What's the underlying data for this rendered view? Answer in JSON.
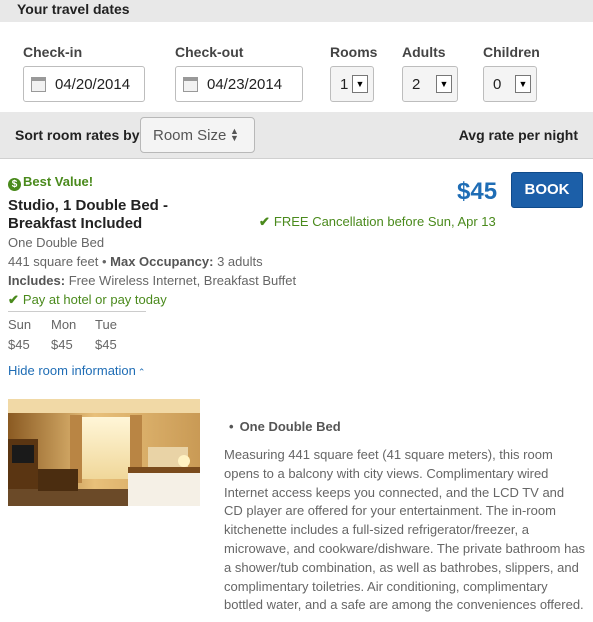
{
  "header": {
    "title": "Your travel dates"
  },
  "search": {
    "checkin_label": "Check-in",
    "checkin_value": "04/20/2014",
    "checkout_label": "Check-out",
    "checkout_value": "04/23/2014",
    "rooms_label": "Rooms",
    "rooms_value": "1",
    "adults_label": "Adults",
    "adults_value": "2",
    "children_label": "Children",
    "children_value": "0"
  },
  "sort": {
    "label": "Sort room rates by:",
    "selected": "Room Size",
    "avg_label": "Avg rate per night"
  },
  "room": {
    "badge": "Best Value!",
    "title": "Studio, 1 Double Bed - Breakfast Included",
    "price": "$45",
    "book_label": "BOOK",
    "cancellation": "FREE Cancellation before Sun, Apr 13",
    "bed_type": "One Double Bed",
    "size": "441 square feet",
    "max_occupancy_label": "Max Occupancy:",
    "max_occupancy_value": "3 adults",
    "includes_label": "Includes:",
    "includes_value": "Free Wireless Internet, Breakfast Buffet",
    "pay_option": "Pay at hotel or pay today",
    "nightly": [
      {
        "day": "Sun",
        "rate": "$45"
      },
      {
        "day": "Mon",
        "rate": "$45"
      },
      {
        "day": "Tue",
        "rate": "$45"
      }
    ],
    "hide_info_label": "Hide room information",
    "detail_heading": "One Double Bed",
    "description": "Measuring 441 square feet (41 square meters), this room opens to a balcony with city views. Complimentary wired Internet access keeps you connected, and the LCD TV and CD player are offered for your entertainment. The in-room kitchenette includes a full-sized refrigerator/freezer, a microwave, and cookware/dishware. The private bathroom has a shower/tub combination, as well as bathrobes, slippers, and complimentary toiletries. Air conditioning, complimentary bottled water, and a safe are among the conveniences offered."
  },
  "colors": {
    "accent_blue": "#1f6db5",
    "book_button": "#1c5fa8",
    "success_green": "#4a8a1c",
    "bar_gray": "#e8e8e8"
  }
}
